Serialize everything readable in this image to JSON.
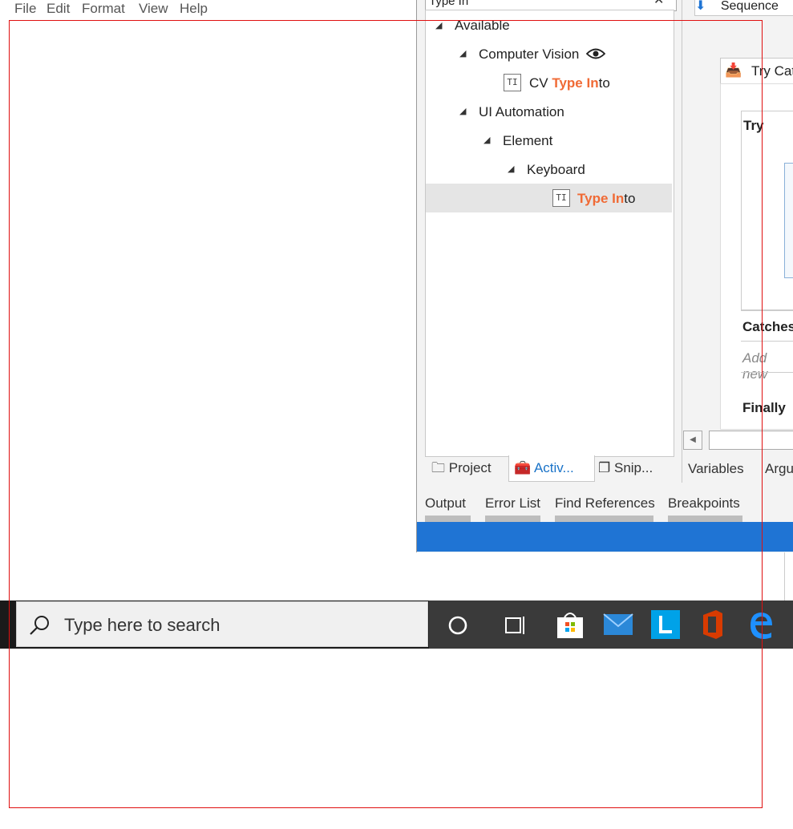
{
  "menubar": {
    "items": [
      "File",
      "Edit",
      "Format",
      "View",
      "Help"
    ]
  },
  "activities": {
    "search_value": "Type In",
    "tree": {
      "available": "Available",
      "computer_vision": "Computer Vision",
      "cv_prefix": "CV ",
      "cv_hl": "Type In",
      "cv_rest": "to",
      "ui_automation": "UI Automation",
      "element": "Element",
      "keyboard": "Keyboard",
      "ti_hl": "Type In",
      "ti_rest": "to"
    },
    "panel_tabs": [
      "Project",
      "Activ...",
      "Snip..."
    ]
  },
  "bottom_tabs": [
    "Output",
    "Error List",
    "Find References",
    "Breakpoints"
  ],
  "designer": {
    "sequence": "Sequence",
    "try_catch": "Try Cat",
    "try": "Try",
    "catches": "Catches",
    "add_new": "Add new",
    "finally": "Finally",
    "tabs": [
      "Variables",
      "Argu"
    ]
  },
  "taskbar": {
    "search_placeholder": "Type here to search"
  },
  "colors": {
    "highlight": "#f06a35",
    "accent": "#1f74d4",
    "outline": "#e01010"
  }
}
